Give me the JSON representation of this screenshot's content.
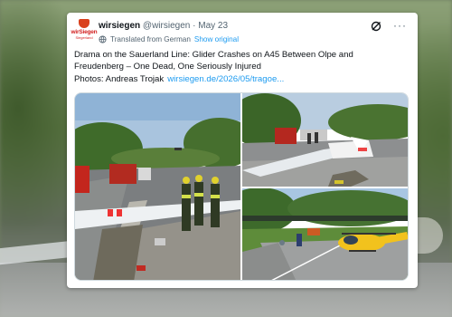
{
  "tweet": {
    "author": {
      "display_name": "wirsiegen",
      "handle": "@wirsiegen",
      "separator": "·",
      "date": "May 23",
      "avatar": {
        "logo_text": "wirSiegen",
        "logo_sub": "Siegerland"
      }
    },
    "translation": {
      "label": "Translated from German",
      "show_original": "Show original"
    },
    "text_lines": [
      "Drama on the Sauerland Line: Glider Crashes on A45 Between Olpe and",
      "Freudenberg – One Dead, One Seriously Injured",
      "Photos: Andreas Trojak"
    ],
    "link_text": "wirsiegen.de/2026/05/tragoe...",
    "icons": [
      "globe-icon",
      "grok-icon",
      "more-icon"
    ],
    "more_label": "···",
    "media": {
      "images": [
        {
          "name": "photo-glider-wreck-road"
        },
        {
          "name": "photo-firefighters-wreck"
        },
        {
          "name": "photo-rescue-helicopter"
        }
      ]
    }
  },
  "colors": {
    "link": "#1d9bf0",
    "text": "#0f1419",
    "muted": "#536471",
    "card": "#ffffff"
  }
}
